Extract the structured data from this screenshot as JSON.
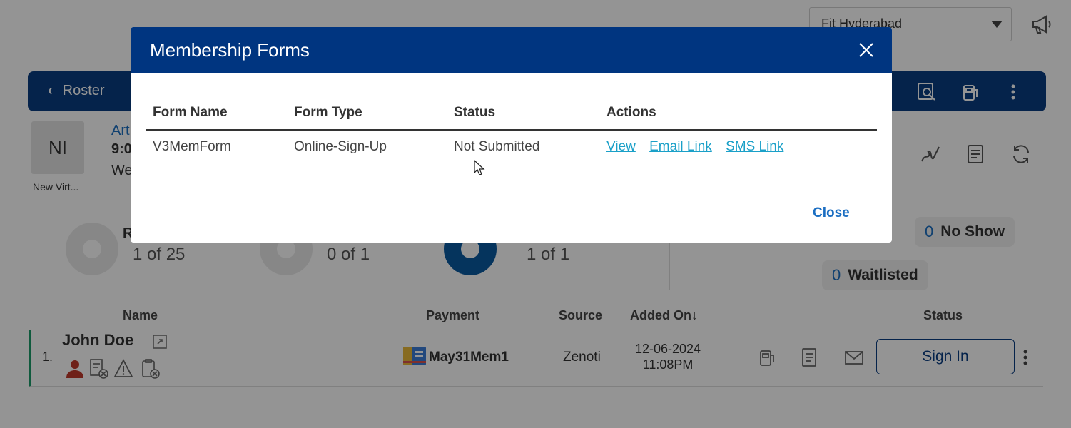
{
  "topbar": {
    "location": "Fit Hyderabad",
    "icons": [
      "chevron-down-icon",
      "megaphone-icon"
    ]
  },
  "navbar": {
    "back_label": "Roster",
    "icons": [
      "search-doc-icon",
      "gas-pump-icon",
      "more-vertical-icon"
    ]
  },
  "class_card": {
    "avatar_initials": "NI",
    "avatar_caption": "New Virt...",
    "title": "Art",
    "time": "9:0",
    "day": "We"
  },
  "right_icons": [
    "signature-icon",
    "document-icon",
    "refresh-icon"
  ],
  "stats": [
    {
      "label": "R",
      "value": "1 of 25"
    },
    {
      "label": "",
      "value": "0 of 1"
    },
    {
      "label": "",
      "value": "1 of 1"
    }
  ],
  "pills": {
    "no_show": {
      "count": "0",
      "label": "No Show"
    },
    "waitlisted": {
      "count": "0",
      "label": "Waitlisted"
    }
  },
  "list": {
    "headers": {
      "name": "Name",
      "payment": "Payment",
      "source": "Source",
      "added_on": "Added On",
      "added_on_sort": "↓",
      "status": "Status"
    },
    "rows": [
      {
        "index": "1.",
        "name": "John Doe",
        "payment": "May31Mem1",
        "source": "Zenoti",
        "added_date": "12-06-2024",
        "added_time": "11:08PM",
        "action_label": "Sign In"
      }
    ]
  },
  "modal": {
    "title": "Membership Forms",
    "columns": [
      "Form Name",
      "Form Type",
      "Status",
      "Actions"
    ],
    "rows": [
      {
        "form_name": "V3MemForm",
        "form_type": "Online-Sign-Up",
        "status": "Not Submitted",
        "actions": [
          "View",
          "Email Link",
          "SMS Link"
        ]
      }
    ],
    "close_label": "Close"
  },
  "colors": {
    "header_blue": "#003580",
    "link_teal": "#1aa0c8",
    "primary_blue": "#1b6ec2",
    "row_accent_green": "#1a9b6a"
  }
}
